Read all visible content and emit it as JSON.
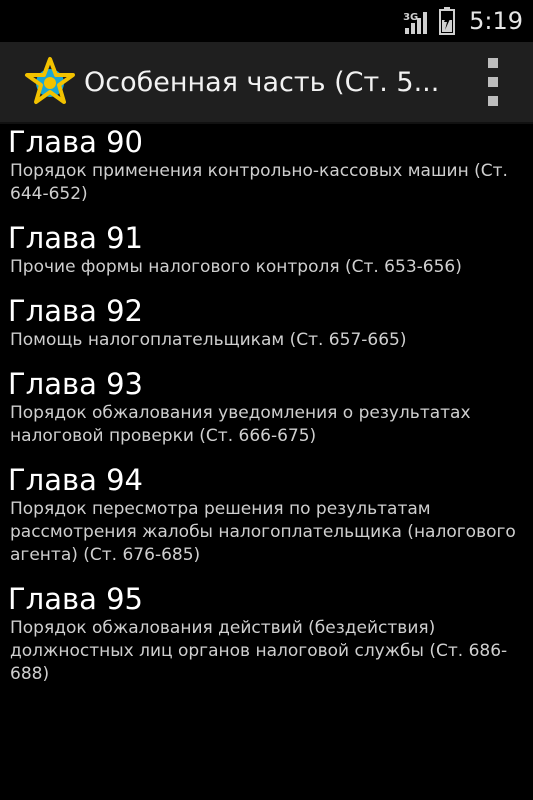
{
  "status_bar": {
    "network": "3G",
    "time": "5:19"
  },
  "action_bar": {
    "title": "Особенная часть (Ст. 5..."
  },
  "chapters": [
    {
      "title": "Глава 90",
      "subtitle": "Порядок применения контрольно-кассовых машин (Ст. 644-652)"
    },
    {
      "title": "Глава 91",
      "subtitle": "Прочие формы налогового контроля (Ст. 653-656)"
    },
    {
      "title": "Глава 92",
      "subtitle": "Помощь налогоплательщикам (Ст. 657-665)"
    },
    {
      "title": "Глава 93",
      "subtitle": "Порядок обжалования уведомления о результатах налоговой проверки (Ст. 666-675)"
    },
    {
      "title": "Глава 94",
      "subtitle": "Порядок пересмотра решения по результатам рассмотрения жалобы налогоплательщика (налогового агента) (Ст. 676-685)"
    },
    {
      "title": "Глава 95",
      "subtitle": "Порядок обжалования действий (бездействия) должностных лиц органов налоговой службы (Ст. 686-688)"
    }
  ],
  "colors": {
    "background": "#000000",
    "action_bar": "#1f1f1f",
    "logo_star": "#f2c200",
    "logo_circle": "#19a7d6"
  },
  "icons": [
    "signal-icon",
    "battery-icon",
    "app-logo-icon",
    "overflow-menu-icon"
  ]
}
